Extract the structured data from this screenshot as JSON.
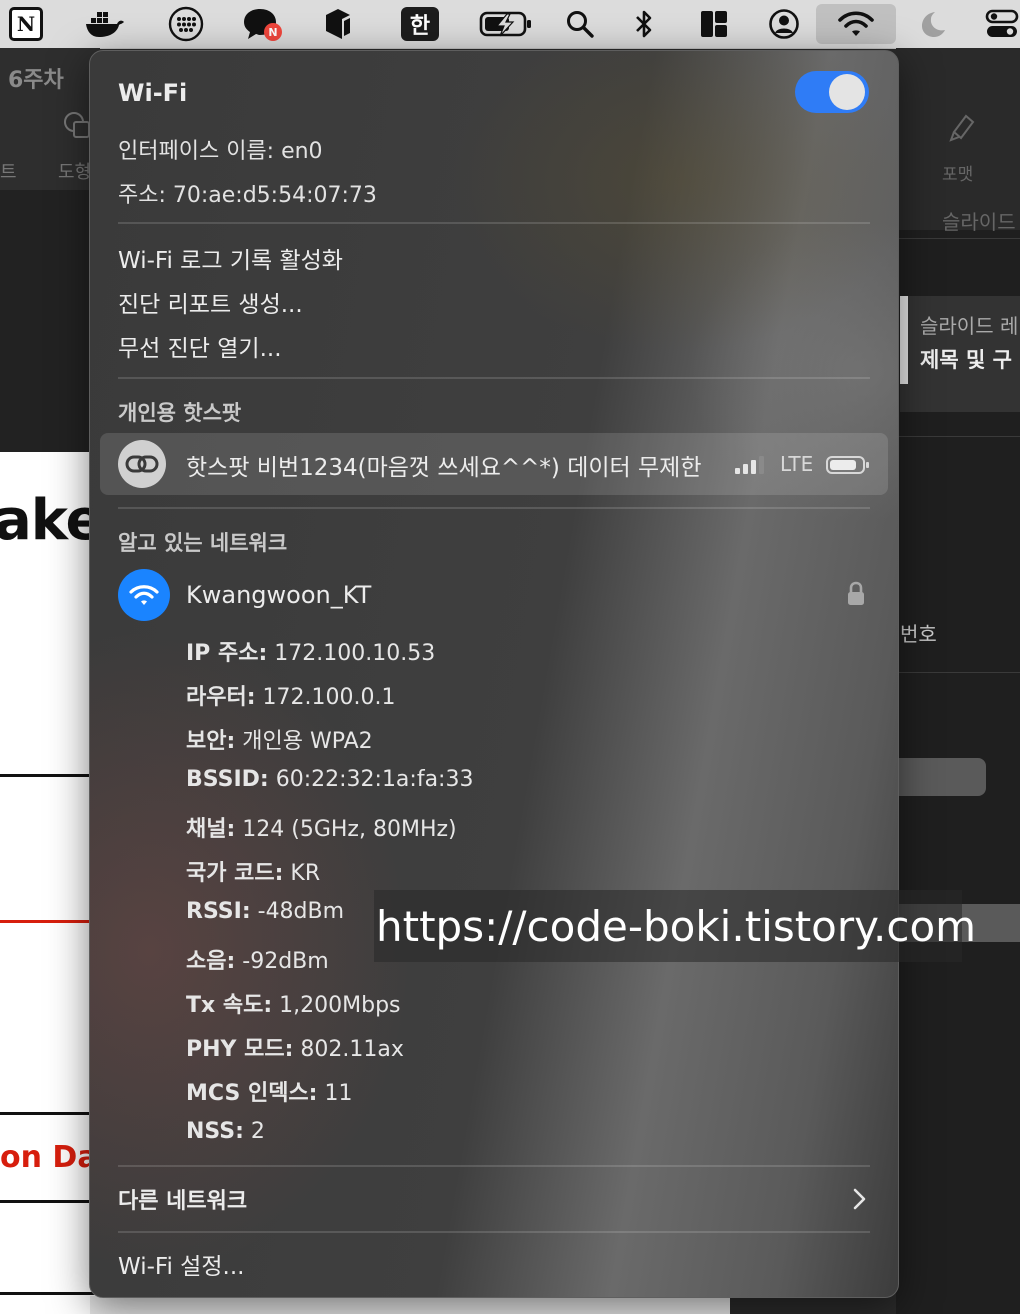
{
  "menubar": {
    "korean_input": "한"
  },
  "background_left": {
    "week": "6주차",
    "tab1": "트",
    "tab2": "도형",
    "big_text": "ake",
    "red_text": "on Dat"
  },
  "background_right": {
    "format_label": "포맷",
    "slide_info_label": "슬라이드",
    "slide_title": "슬라이드 레",
    "slide_subtitle": "제목 및 구",
    "partial_text": "번호"
  },
  "wifi_panel": {
    "title": "Wi-Fi",
    "toggle_on": true,
    "interface_name": "인터페이스 이름: en0",
    "address": "주소: 70:ae:d5:54:07:73",
    "menu": [
      "Wi-Fi 로그 기록 활성화",
      "진단 리포트 생성...",
      "무선 진단 열기..."
    ],
    "hotspot_section": "개인용 핫스팟",
    "hotspot": {
      "name": "핫스팟 비번1234(마음껏 쓰세요^^*) 데이터 무제한",
      "network_type": "LTE"
    },
    "known_section": "알고 있는 네트워크",
    "known_network": {
      "name": "Kwangwoon_KT",
      "details": [
        {
          "label": "IP 주소:",
          "value": "172.100.10.53"
        },
        {
          "label": "라우터:",
          "value": "172.100.0.1"
        },
        {
          "label": "보안:",
          "value": "개인용 WPA2"
        },
        {
          "label": "BSSID:",
          "value": "60:22:32:1a:fa:33"
        },
        {
          "label": "채널:",
          "value": "124 (5GHz, 80MHz)"
        },
        {
          "label": "국가 코드:",
          "value": "KR"
        },
        {
          "label": "RSSI:",
          "value": "-48dBm"
        },
        {
          "label": "소음:",
          "value": "-92dBm"
        },
        {
          "label": "Tx 속도:",
          "value": "1,200Mbps"
        },
        {
          "label": "PHY 모드:",
          "value": "802.11ax"
        },
        {
          "label": "MCS 인덱스:",
          "value": "11"
        },
        {
          "label": "NSS:",
          "value": "2"
        }
      ]
    },
    "other_networks": "다른 네트워크",
    "settings": "Wi-Fi 설정..."
  },
  "watermark": "https://code-boki.tistory.com",
  "colors": {
    "toggle_blue": "#2f7cf6",
    "known_network_blue": "#1a84ff",
    "red_accent": "#d71e0d"
  }
}
